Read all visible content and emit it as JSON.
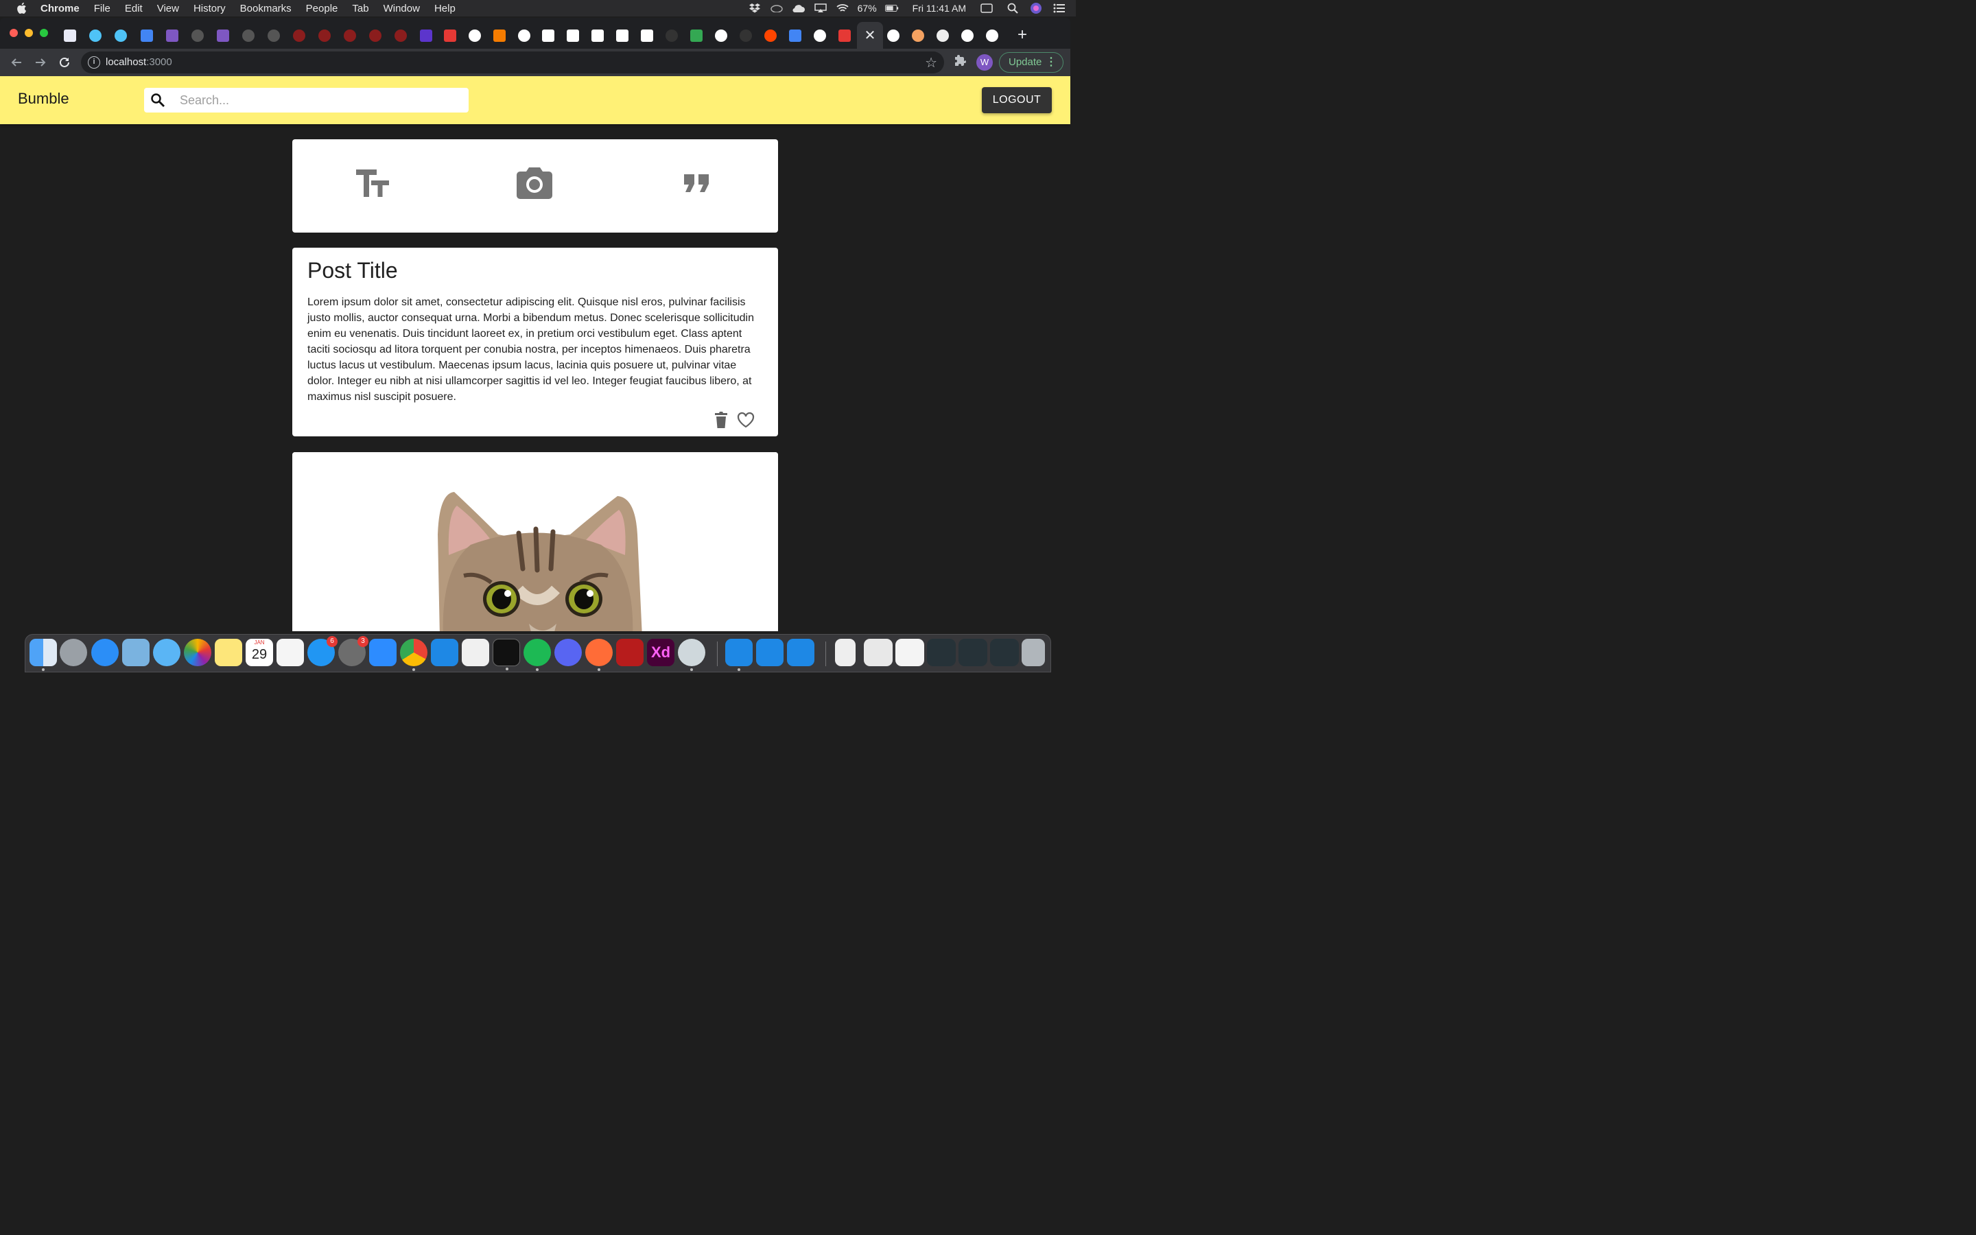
{
  "menubar": {
    "app_name": "Chrome",
    "items": [
      "File",
      "Edit",
      "View",
      "History",
      "Bookmarks",
      "People",
      "Tab",
      "Window",
      "Help"
    ],
    "battery": "67%",
    "clock": "Fri 11:41 AM"
  },
  "browser": {
    "url_host": "localhost",
    "url_port": ":3000",
    "profile_initial": "W",
    "update_label": "Update",
    "close_tab_glyph": "✕",
    "new_tab_glyph": "+"
  },
  "app": {
    "brand": "Bumble",
    "search_placeholder": "Search...",
    "logout_label": "LOGOUT",
    "appbar_color": "#fff176",
    "composer_options": [
      "text-post-icon",
      "photo-post-icon",
      "quote-post-icon"
    ],
    "post": {
      "title": "Post Title",
      "body": "Lorem ipsum dolor sit amet, consectetur adipiscing elit. Quisque nisl eros, pulvinar facilisis justo mollis, auctor consequat urna. Morbi a bibendum metus. Donec scelerisque sollicitudin enim eu venenatis. Duis tincidunt laoreet ex, in pretium orci vestibulum eget. Class aptent taciti sociosqu ad litora torquent per conubia nostra, per inceptos himenaeos. Duis pharetra luctus lacus ut vestibulum. Maecenas ipsum lacus, lacinia quis posuere ut, pulvinar vitae dolor. Integer eu nibh at nisi ullamcorper sagittis id vel leo. Integer feugiat faucibus libero, at maximus nisl suscipit posuere."
    }
  },
  "dock": {
    "app_store_badge": "6",
    "system_prefs_badge": "3",
    "calendar_month": "JAN",
    "calendar_day": "29",
    "xd_label": "Xd"
  }
}
